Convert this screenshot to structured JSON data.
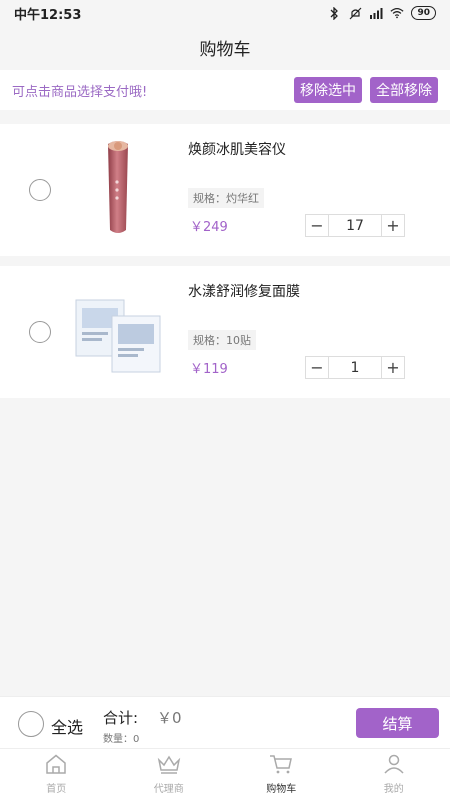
{
  "status_bar": {
    "time": "中午12:53",
    "battery": "90"
  },
  "header": {
    "title": "购物车"
  },
  "notice": {
    "text": "可点击商品选择支付哦!",
    "remove_selected_label": "移除选中",
    "remove_all_label": "全部移除"
  },
  "cart": {
    "items": [
      {
        "name": "焕颜冰肌美容仪",
        "spec": "规格：灼华红",
        "price": "￥249",
        "quantity": "17",
        "image": "beauty-device",
        "image_color": "#b0505a"
      },
      {
        "name": "水漾舒润修复面膜",
        "spec": "规格：10贴",
        "price": "￥119",
        "quantity": "1",
        "image": "face-mask-pack",
        "image_color": "#c9d7ea"
      }
    ]
  },
  "footer": {
    "select_all_label": "全选",
    "total_label": "合计:",
    "total_value": "￥0",
    "count_label": "数量：0",
    "checkout_label": "结算"
  },
  "tabs": [
    {
      "label": "首页",
      "icon": "home-icon"
    },
    {
      "label": "代理商",
      "icon": "crown-icon"
    },
    {
      "label": "购物车",
      "icon": "cart-icon",
      "active": true
    },
    {
      "label": "我的",
      "icon": "user-icon"
    }
  ],
  "colors": {
    "accent": "#a263c9",
    "notice_text": "#9b6ac4"
  }
}
